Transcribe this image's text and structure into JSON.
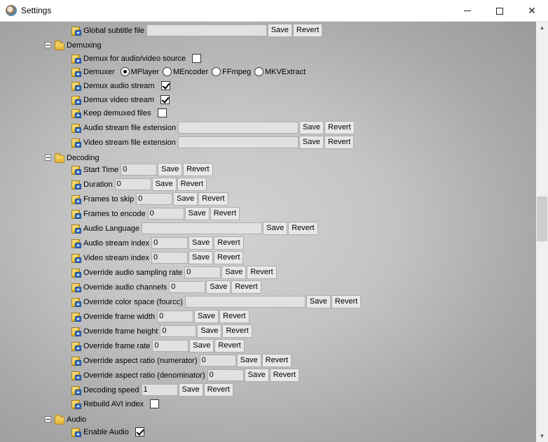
{
  "window": {
    "title": "Settings"
  },
  "colors": {
    "content_background": "#c4c4c4",
    "field": "#e1e1e1"
  },
  "icons": {
    "app": "settings-app-icon",
    "folder": "folder-icon",
    "leaf": "setting-icon"
  },
  "common": {
    "save": "Save",
    "revert": "Revert"
  },
  "rows": [
    {
      "kind": "text",
      "depth": 2,
      "label": "Global subtitle file",
      "value": ""
    },
    {
      "kind": "folder",
      "depth": 1,
      "label": "Demuxing"
    },
    {
      "kind": "check",
      "depth": 2,
      "label": "Demux for audio/video source",
      "checked": false
    },
    {
      "kind": "radio",
      "depth": 2,
      "label": "Demuxer",
      "options": [
        "MPlayer",
        "MEncoder",
        "FFmpeg",
        "MKVExtract"
      ],
      "selected": 0
    },
    {
      "kind": "check",
      "depth": 2,
      "label": "Demux audio stream",
      "checked": true
    },
    {
      "kind": "check",
      "depth": 2,
      "label": "Demux video stream",
      "checked": true
    },
    {
      "kind": "check",
      "depth": 2,
      "label": "Keep demuxed files",
      "checked": false
    },
    {
      "kind": "text",
      "depth": 2,
      "label": "Audio stream file extension",
      "value": ""
    },
    {
      "kind": "text",
      "depth": 2,
      "label": "Video stream file extension",
      "value": ""
    },
    {
      "kind": "folder",
      "depth": 1,
      "label": "Decoding"
    },
    {
      "kind": "text",
      "depth": 2,
      "label": "Start Time",
      "value": "0"
    },
    {
      "kind": "text",
      "depth": 2,
      "label": "Duration",
      "value": "0"
    },
    {
      "kind": "text",
      "depth": 2,
      "label": "Frames to skip",
      "value": "0"
    },
    {
      "kind": "text",
      "depth": 2,
      "label": "Frames to encode",
      "value": "0"
    },
    {
      "kind": "text",
      "depth": 2,
      "label": "Audio Language",
      "value": ""
    },
    {
      "kind": "text",
      "depth": 2,
      "label": "Audio stream index",
      "value": "0"
    },
    {
      "kind": "text",
      "depth": 2,
      "label": "Video stream index",
      "value": "0"
    },
    {
      "kind": "text",
      "depth": 2,
      "label": "Override audio sampling rate",
      "value": "0"
    },
    {
      "kind": "text",
      "depth": 2,
      "label": "Override audio channels",
      "value": "0"
    },
    {
      "kind": "text",
      "depth": 2,
      "label": "Override color space (fourcc)",
      "value": ""
    },
    {
      "kind": "text",
      "depth": 2,
      "label": "Override frame width",
      "value": "0"
    },
    {
      "kind": "text",
      "depth": 2,
      "label": "Override frame height",
      "value": "0"
    },
    {
      "kind": "text",
      "depth": 2,
      "label": "Override frame rate",
      "value": "0"
    },
    {
      "kind": "text",
      "depth": 2,
      "label": "Override aspect ratio (numerator)",
      "value": "0"
    },
    {
      "kind": "text",
      "depth": 2,
      "label": "Override aspect ratio (denominator)",
      "value": "0"
    },
    {
      "kind": "text",
      "depth": 2,
      "label": "Decoding speed",
      "value": "1"
    },
    {
      "kind": "check",
      "depth": 2,
      "label": "Rebuild AVI index",
      "checked": false
    },
    {
      "kind": "folder",
      "depth": 1,
      "label": "Audio"
    },
    {
      "kind": "check",
      "depth": 2,
      "label": "Enable Audio",
      "checked": true
    }
  ]
}
